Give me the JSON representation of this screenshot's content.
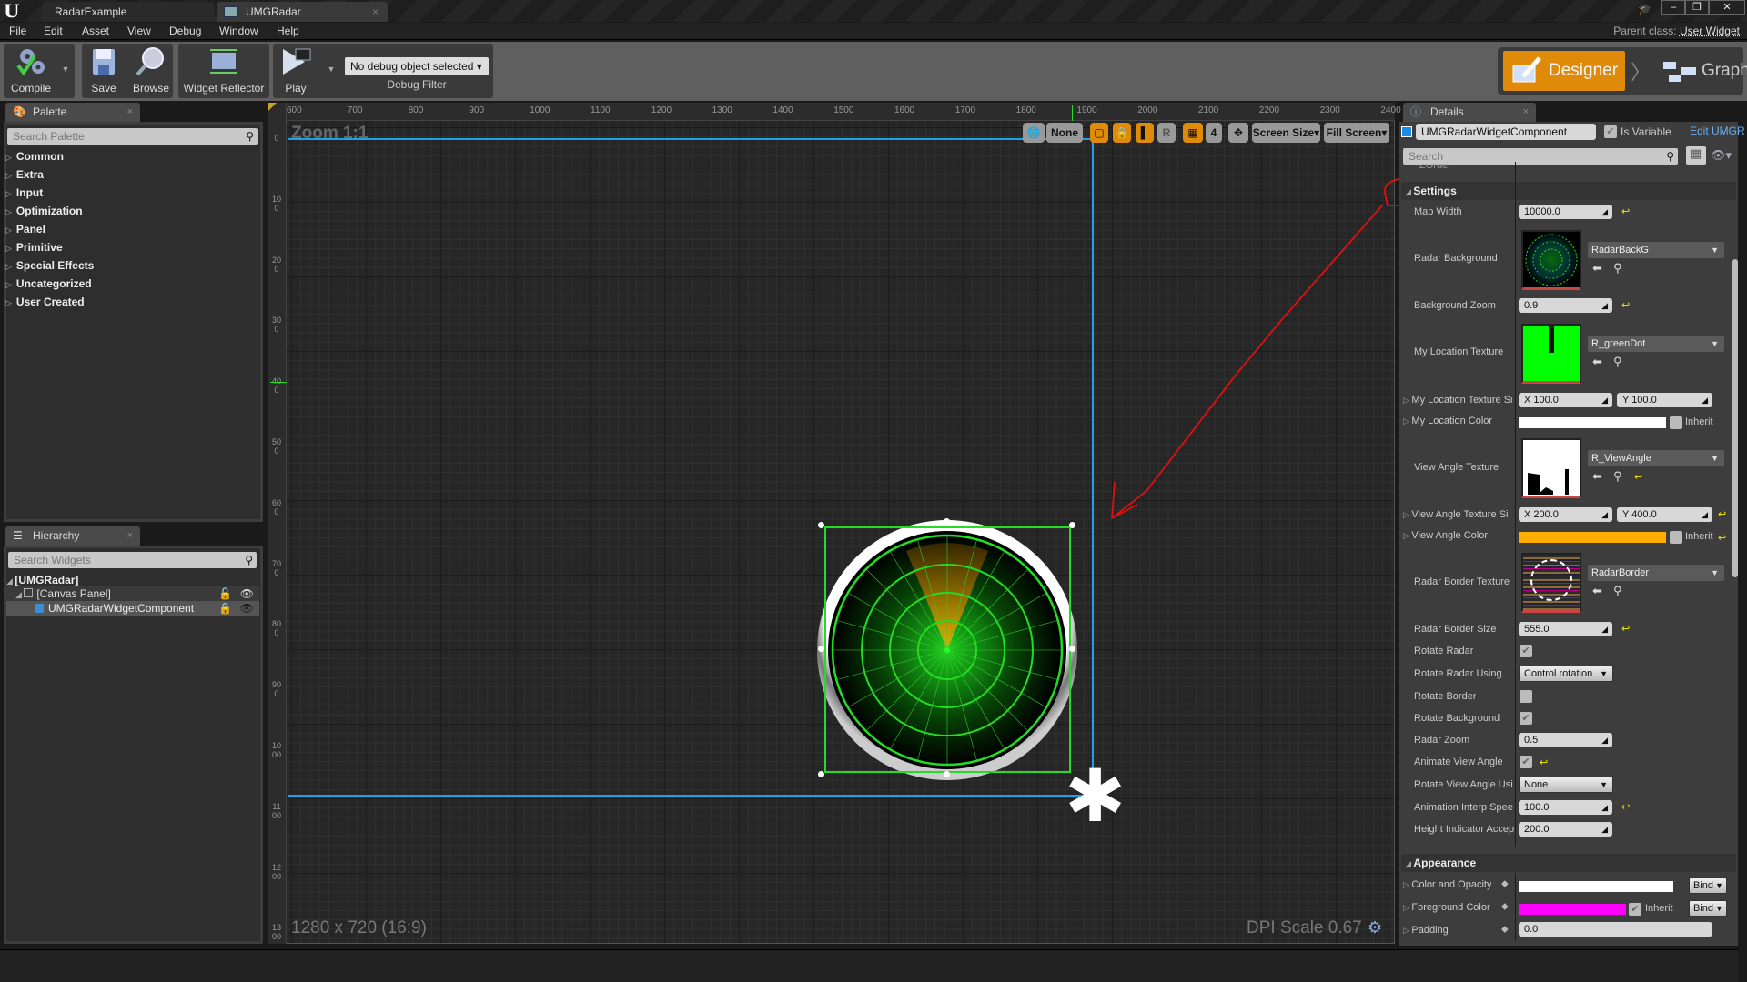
{
  "window": {
    "tabs": [
      {
        "label": "RadarExample"
      },
      {
        "label": "UMGRadar",
        "close": "×"
      }
    ],
    "controls": {
      "minimize": "–",
      "restore": "❐",
      "close": "✕"
    }
  },
  "menu": {
    "items": [
      "File",
      "Edit",
      "Asset",
      "View",
      "Debug",
      "Window",
      "Help"
    ],
    "parent_class_label": "Parent class:",
    "parent_class_value": "User Widget"
  },
  "toolbar": {
    "compile": "Compile",
    "save": "Save",
    "browse": "Browse",
    "widget_reflector": "Widget Reflector",
    "play": "Play",
    "debug_object": "No debug object selected",
    "debug_filter": "Debug Filter",
    "designer": "Designer",
    "graph": "Graph"
  },
  "palette": {
    "title": "Palette",
    "search_placeholder": "Search Palette",
    "categories": [
      "Common",
      "Extra",
      "Input",
      "Optimization",
      "Panel",
      "Primitive",
      "Special Effects",
      "Uncategorized",
      "User Created"
    ]
  },
  "hierarchy": {
    "title": "Hierarchy",
    "search_placeholder": "Search Widgets",
    "root": "[UMGRadar]",
    "canvas_panel": "[Canvas Panel]",
    "component": "UMGRadarWidgetComponent"
  },
  "viewport": {
    "zoom_label": "Zoom 1:1",
    "resolution_label": "1280 x 720 (16:9)",
    "dpi_label": "DPI Scale 0.67",
    "ruler_top": [
      "600",
      "700",
      "800",
      "900",
      "1000",
      "1100",
      "1200",
      "1300",
      "1400",
      "1500",
      "1600",
      "1700",
      "1800",
      "1900",
      "2000",
      "2100",
      "2200",
      "2300",
      "2400"
    ],
    "ruler_left": [
      "0",
      "100",
      "200",
      "300",
      "400",
      "500",
      "600",
      "700",
      "800",
      "900",
      "1000",
      "1100",
      "1200",
      "1300"
    ],
    "tools": {
      "localization": "None",
      "grid_size": "4",
      "respect_lock": "R",
      "screen_size": "Screen Size",
      "fill_screen": "Fill Screen"
    }
  },
  "details": {
    "title": "Details",
    "widget_name": "UMGRadarWidgetComponent",
    "is_variable_label": "Is Variable",
    "is_variable": true,
    "edit_link": "Edit UMGR",
    "search_placeholder": "Search",
    "zorder_label": "ZOrder",
    "settings_section": "Settings",
    "settings": {
      "map_width": {
        "label": "Map Width",
        "value": "10000.0"
      },
      "radar_background": {
        "label": "Radar Background",
        "asset": "RadarBackG"
      },
      "background_zoom": {
        "label": "Background Zoom",
        "value": "0.9"
      },
      "my_location_texture": {
        "label": "My Location Texture",
        "asset": "R_greenDot"
      },
      "my_location_texture_size": {
        "label": "My Location Texture Size",
        "x": "X  100.0",
        "y": "Y  100.0"
      },
      "my_location_color": {
        "label": "My Location Color",
        "color": "#ffffff",
        "inherit": "Inherit"
      },
      "view_angle_texture": {
        "label": "View Angle Texture",
        "asset": "R_ViewAngle"
      },
      "view_angle_texture_size": {
        "label": "View Angle Texture Si",
        "x": "X  200.0",
        "y": "Y  400.0"
      },
      "view_angle_color": {
        "label": "View Angle Color",
        "color": "#ffae00",
        "inherit": "Inherit"
      },
      "radar_border_texture": {
        "label": "Radar Border Texture",
        "asset": "RadarBorder"
      },
      "radar_border_size": {
        "label": "Radar Border Size",
        "value": "555.0"
      },
      "rotate_radar": {
        "label": "Rotate Radar",
        "checked": true
      },
      "rotate_radar_using": {
        "label": "Rotate Radar Using",
        "value": "Control rotation"
      },
      "rotate_border": {
        "label": "Rotate Border",
        "checked": false
      },
      "rotate_background": {
        "label": "Rotate Background",
        "checked": true
      },
      "radar_zoom": {
        "label": "Radar Zoom",
        "value": "0.5"
      },
      "animate_view_angle": {
        "label": "Animate View Angle",
        "checked": true
      },
      "rotate_view_angle_using": {
        "label": "Rotate View Angle Usi",
        "value": "None"
      },
      "animation_interp_speed": {
        "label": "Animation Interp Spee",
        "value": "100.0"
      },
      "height_indicator_accept": {
        "label": "Height Indicator Accep",
        "value": "200.0"
      }
    },
    "appearance_section": "Appearance",
    "appearance": {
      "color_and_opacity": {
        "label": "Color and Opacity",
        "color": "#ffffff",
        "bind": "Bind"
      },
      "foreground_color": {
        "label": "Foreground Color",
        "color": "#ff00ff",
        "inherit": "Inherit",
        "bind": "Bind"
      },
      "padding": {
        "label": "Padding",
        "value": "0.0"
      }
    }
  },
  "colors": {
    "accent": "#e08a0a",
    "selection": "#22dd22",
    "guide": "#1aa3e8",
    "annotation": "#e01010"
  }
}
